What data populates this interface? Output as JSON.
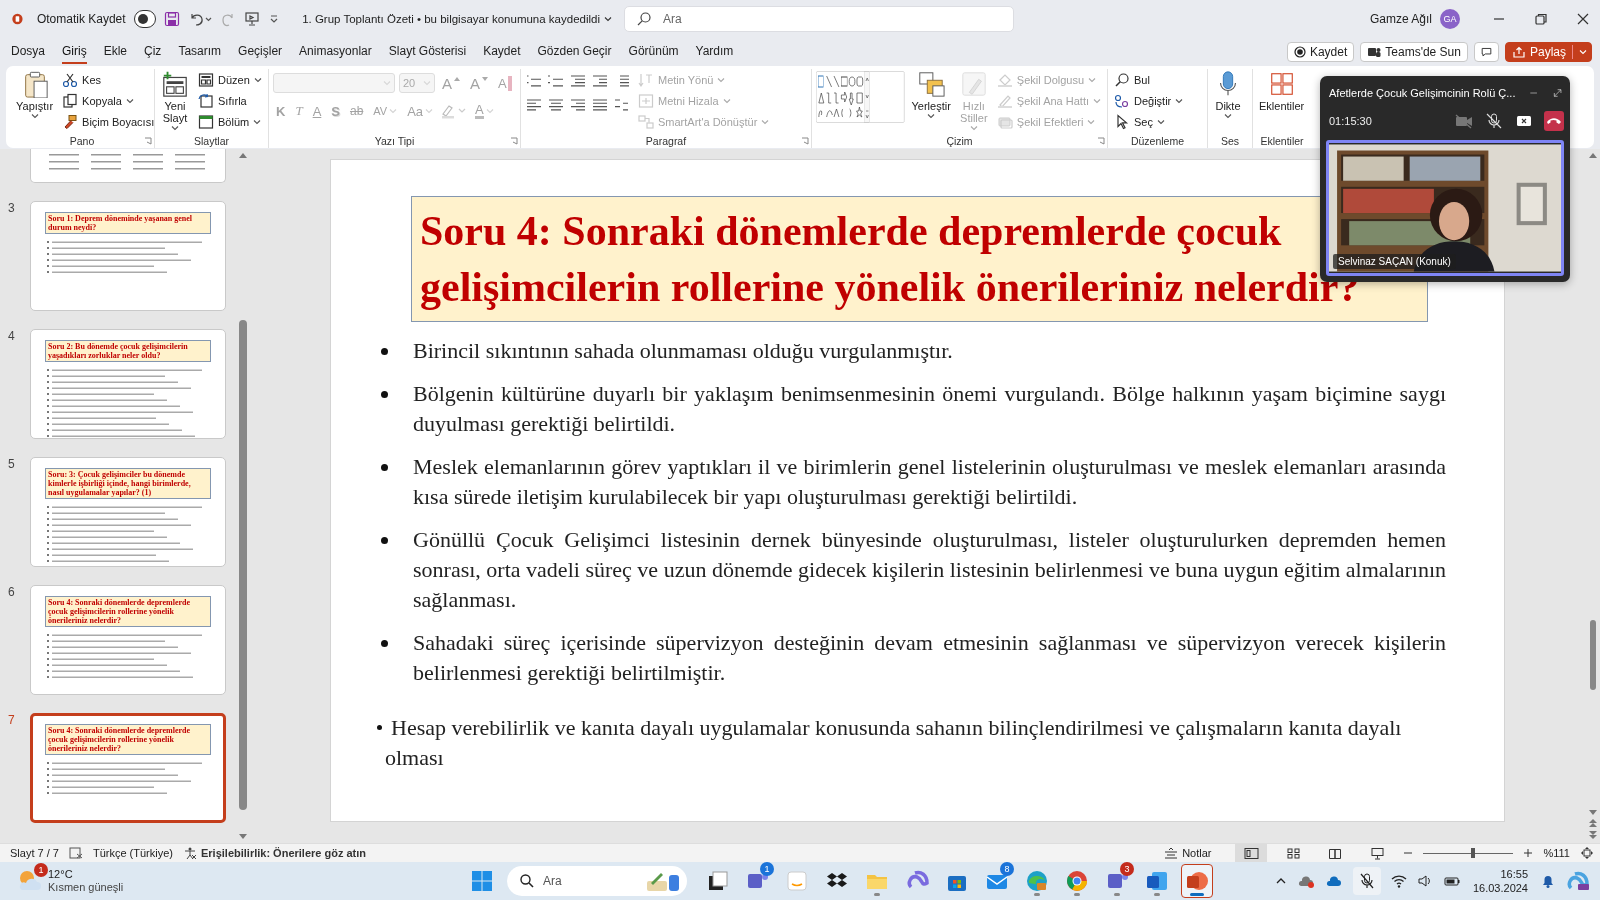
{
  "title_bar": {
    "autosave_label": "Otomatik Kaydet",
    "autosave_on": false,
    "document_title": "1. Grup Toplantı Özeti • bu bilgisayar konumuna kaydedildi",
    "search_placeholder": "Ara",
    "user_name": "Gamze Ağıl",
    "user_initials": "GA"
  },
  "menu_tabs": [
    {
      "label": "Dosya",
      "selected": false
    },
    {
      "label": "Giriş",
      "selected": true
    },
    {
      "label": "Ekle",
      "selected": false
    },
    {
      "label": "Çiz",
      "selected": false
    },
    {
      "label": "Tasarım",
      "selected": false
    },
    {
      "label": "Geçişler",
      "selected": false
    },
    {
      "label": "Animasyonlar",
      "selected": false
    },
    {
      "label": "Slayt Gösterisi",
      "selected": false
    },
    {
      "label": "Kaydet",
      "selected": false
    },
    {
      "label": "Gözden Geçir",
      "selected": false
    },
    {
      "label": "Görünüm",
      "selected": false
    },
    {
      "label": "Yardım",
      "selected": false
    }
  ],
  "header_buttons": [
    {
      "kind": "record",
      "label": "Kaydet"
    },
    {
      "kind": "teams",
      "label": "Teams'de Sun"
    },
    {
      "kind": "comments"
    },
    {
      "kind": "share",
      "label": "Paylaş"
    }
  ],
  "ribbon": {
    "groups": [
      {
        "label": "Pano",
        "launcher": true,
        "parts": [
          {
            "kind": "large",
            "label": "Yapıştır",
            "dropdown": true,
            "disabled": false
          },
          {
            "kind": "stack",
            "items": [
              {
                "label": "Kes",
                "dropdown": false,
                "disabled": false
              },
              {
                "label": "Kopyala",
                "dropdown": true,
                "disabled": false
              },
              {
                "label": "Biçim Boyacısı",
                "dropdown": false,
                "disabled": false
              }
            ]
          }
        ]
      },
      {
        "label": "Slaytlar",
        "launcher": false,
        "parts": [
          {
            "kind": "large",
            "label": "Yeni Slayt",
            "dropdown": true,
            "disabled": false
          },
          {
            "kind": "stack",
            "items": [
              {
                "label": "Düzen",
                "dropdown": true,
                "disabled": false
              },
              {
                "label": "Sıfırla",
                "dropdown": false,
                "disabled": false
              },
              {
                "label": "Bölüm",
                "dropdown": true,
                "disabled": false
              }
            ]
          }
        ]
      },
      {
        "label": "Yazı Tipi",
        "launcher": true,
        "parts": [
          {
            "kind": "font",
            "row1": [
              {
                "kind": "fontbox",
                "disabled": true
              },
              {
                "kind": "sizebox",
                "value": "20",
                "disabled": true
              },
              {
                "kind": "grow",
                "text": "A",
                "disabled": true
              },
              {
                "kind": "shrink",
                "text": "A",
                "disabled": true
              },
              {
                "kind": "clear",
                "text": "A",
                "disabled": true
              }
            ],
            "row2": [
              {
                "kind": "bold",
                "text": "K",
                "disabled": true
              },
              {
                "kind": "italic",
                "text": "T",
                "disabled": true
              },
              {
                "kind": "underline",
                "text": "A",
                "disabled": true
              },
              {
                "kind": "shadow",
                "text": "S",
                "disabled": true
              },
              {
                "kind": "strike",
                "text": "ab",
                "disabled": true
              },
              {
                "kind": "spacing",
                "text": "AV",
                "disabled": true
              },
              {
                "kind": "case",
                "text": "Aa",
                "disabled": true
              },
              {
                "kind": "highlight",
                "disabled": true
              },
              {
                "kind": "fontcolor",
                "text": "A",
                "disabled": true
              }
            ]
          }
        ]
      },
      {
        "label": "Paragraf",
        "launcher": true,
        "parts": [
          {
            "kind": "para-icons"
          },
          {
            "kind": "stack",
            "items": [
              {
                "label": "Metin Yönü",
                "dropdown": true,
                "disabled": true
              },
              {
                "label": "Metni Hizala",
                "dropdown": true,
                "disabled": true
              },
              {
                "label": "SmartArt'a Dönüştür",
                "dropdown": true,
                "disabled": true
              }
            ]
          }
        ]
      },
      {
        "label": "Çizim",
        "launcher": true,
        "parts": [
          {
            "kind": "gallery"
          },
          {
            "kind": "large",
            "label": "Yerleştir",
            "dropdown": true,
            "disabled": false
          },
          {
            "kind": "large",
            "label": "Hızlı Stiller",
            "dropdown": true,
            "disabled": true
          },
          {
            "kind": "stack",
            "items": [
              {
                "label": "Şekil Dolgusu",
                "dropdown": true,
                "disabled": true
              },
              {
                "label": "Şekil Ana Hattı",
                "dropdown": true,
                "disabled": true
              },
              {
                "label": "Şekil Efektleri",
                "dropdown": true,
                "disabled": true
              }
            ]
          }
        ]
      },
      {
        "label": "Düzenleme",
        "launcher": false,
        "parts": [
          {
            "kind": "stack",
            "items": [
              {
                "label": "Bul",
                "dropdown": false,
                "disabled": false
              },
              {
                "label": "Değiştir",
                "dropdown": true,
                "disabled": false
              },
              {
                "label": "Seç",
                "dropdown": true,
                "disabled": false
              }
            ]
          }
        ]
      },
      {
        "label": "Ses",
        "launcher": false,
        "parts": [
          {
            "kind": "large",
            "label": "Dikte",
            "dropdown": true,
            "disabled": false
          }
        ]
      },
      {
        "label": "Eklentiler",
        "launcher": false,
        "parts": [
          {
            "kind": "large",
            "label": "Eklentiler",
            "dropdown": false,
            "disabled": false
          }
        ]
      }
    ]
  },
  "thumbnails": [
    {
      "number": "3",
      "title": "Soru 1: Deprem döneminde yaşanan genel durum neydi?",
      "selected": false
    },
    {
      "number": "4",
      "title": "Soru 2: Bu dönemde çocuk gelişimcilerin yaşadıkları zorluklar neler oldu?",
      "selected": false
    },
    {
      "number": "5",
      "title": "Soru: 3: Çocuk gelişimciler bu dönemde kimlerle işbirliği içinde, hangi birimlerde, nasıl uygulamalar yapılar? (1)",
      "selected": false
    },
    {
      "number": "6",
      "title": "Soru 4: Sonraki dönemlerde depremlerde çocuk gelişimcilerin rollerine yönelik önerileriniz nelerdir?",
      "selected": false
    },
    {
      "number": "7",
      "title": "Soru 4: Sonraki dönemlerde depremlerde çocuk gelişimcilerin rollerine yönelik önerileriniz nelerdir?",
      "selected": true
    }
  ],
  "slide": {
    "title": "Soru 4: Sonraki dönemlerde depremlerde çocuk gelişimcilerin rollerine yönelik önerileriniz nelerdir?",
    "bullets": [
      {
        "kind": "normal",
        "text": "Birincil sıkıntının sahada olunmaması olduğu vurgulanmıştır."
      },
      {
        "kind": "normal",
        "text": "Bölgenin kültürüne duyarlı bir yaklaşım benimsenmesinin önemi vurgulandı. Bölge halkının yaşam biçimine saygı duyulması gerektiği belirtildi."
      },
      {
        "kind": "normal",
        "text": "Meslek elemanlarının görev yaptıkları il ve birimlerin genel listelerinin oluşturulması ve meslek elemanları arasında kısa sürede iletişim kurulabilecek bir yapı oluşturulması gerektiği belirtildi."
      },
      {
        "kind": "normal",
        "text": "Gönüllü Çocuk Gelişimci listesinin dernek bünyesinde oluşturulması, listeler oluşturulurken depremden hemen sonrası, orta vadeli süreç ve uzun dönemde gidecek kişilerin listesinin belirlenmesi ve buna uygun eğitim almalarının sağlanması."
      },
      {
        "kind": "normal",
        "text": "Sahadaki süreç içerisinde süpervizyon desteğinin devam etmesinin sağlanması ve süpervizyon verecek kişilerin belirlenmesi gerektiği belirtilmiştir."
      },
      {
        "kind": "alt",
        "text": "Hesap verebilirlik ve kanıta dayalı uygulamalar konusunda sahanın bilinçlendirilmesi ve çalışmaların kanıta dayalı olması"
      }
    ]
  },
  "call_window": {
    "title": "Afetlerde Çocuk Gelişimcinin Rolü Ç...",
    "timer": "01:15:30",
    "participant": "Selvinaz SAÇAN (Konuk)"
  },
  "status_bar": {
    "slide_counter": "Slayt 7 / 7",
    "language": "Türkçe (Türkiye)",
    "accessibility": "Erişilebilirlik: Önerilere göz atın",
    "notes": "Notlar",
    "views": [
      {
        "selected": true
      },
      {
        "selected": false
      },
      {
        "selected": false
      },
      {
        "selected": false
      }
    ],
    "zoom": {
      "level": 0.55,
      "reading": "%111"
    }
  },
  "taskbar": {
    "weather": {
      "temperature": "12°C",
      "condition": "Kısmen güneşli",
      "badge": "1"
    },
    "search_placeholder": "Ara",
    "apps": [
      {
        "running": false,
        "selected": false
      },
      {
        "running": false,
        "selected": false,
        "badge": "1"
      },
      {
        "running": false,
        "selected": false
      },
      {
        "running": false,
        "selected": false
      },
      {
        "running": true,
        "selected": false
      },
      {
        "running": false,
        "selected": false
      },
      {
        "running": false,
        "selected": false
      },
      {
        "running": false,
        "selected": false,
        "badge": "8"
      },
      {
        "running": true,
        "selected": false
      },
      {
        "running": true,
        "selected": false
      },
      {
        "running": true,
        "selected": false,
        "badge": "3"
      },
      {
        "running": true,
        "selected": false
      },
      {
        "running": true,
        "selected": true
      }
    ],
    "clock": {
      "time": "16:55",
      "date": "16.03.2024"
    }
  }
}
